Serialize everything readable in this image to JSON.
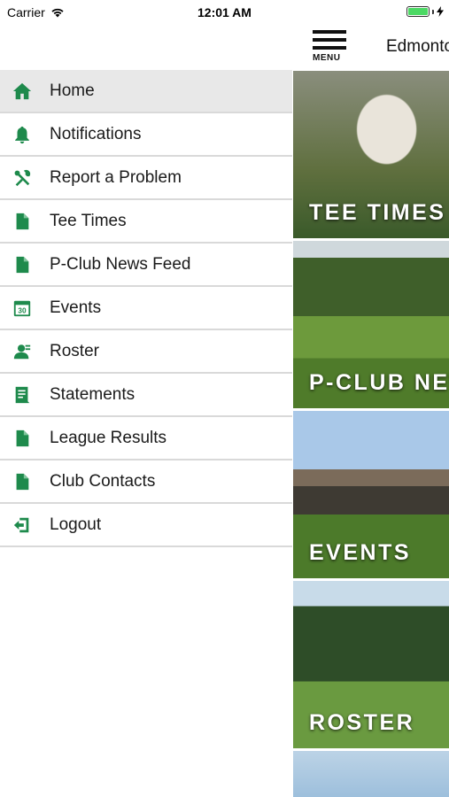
{
  "status_bar": {
    "carrier": "Carrier",
    "time": "12:01 AM"
  },
  "header": {
    "menu_label": "MENU",
    "club_name": "Edmonton"
  },
  "menu": {
    "items": [
      {
        "label": "Home",
        "icon": "home-icon",
        "active": true
      },
      {
        "label": "Notifications",
        "icon": "bell-icon"
      },
      {
        "label": "Report a Problem",
        "icon": "tools-icon"
      },
      {
        "label": "Tee Times",
        "icon": "document-icon"
      },
      {
        "label": "P-Club News Feed",
        "icon": "document-icon"
      },
      {
        "label": "Events",
        "icon": "calendar-icon",
        "calendar_day": "30"
      },
      {
        "label": "Roster",
        "icon": "person-icon"
      },
      {
        "label": "Statements",
        "icon": "statement-icon"
      },
      {
        "label": "League Results",
        "icon": "document-icon"
      },
      {
        "label": "Club Contacts",
        "icon": "document-icon"
      },
      {
        "label": "Logout",
        "icon": "logout-icon"
      }
    ]
  },
  "tiles": [
    {
      "caption": "TEE TIMES"
    },
    {
      "caption": "P-CLUB NEWS FEED"
    },
    {
      "caption": "EVENTS"
    },
    {
      "caption": "ROSTER"
    }
  ],
  "colors": {
    "accent": "#1e8a4c",
    "active_bg": "#e8e8e8",
    "divider": "#d9d9d9"
  }
}
